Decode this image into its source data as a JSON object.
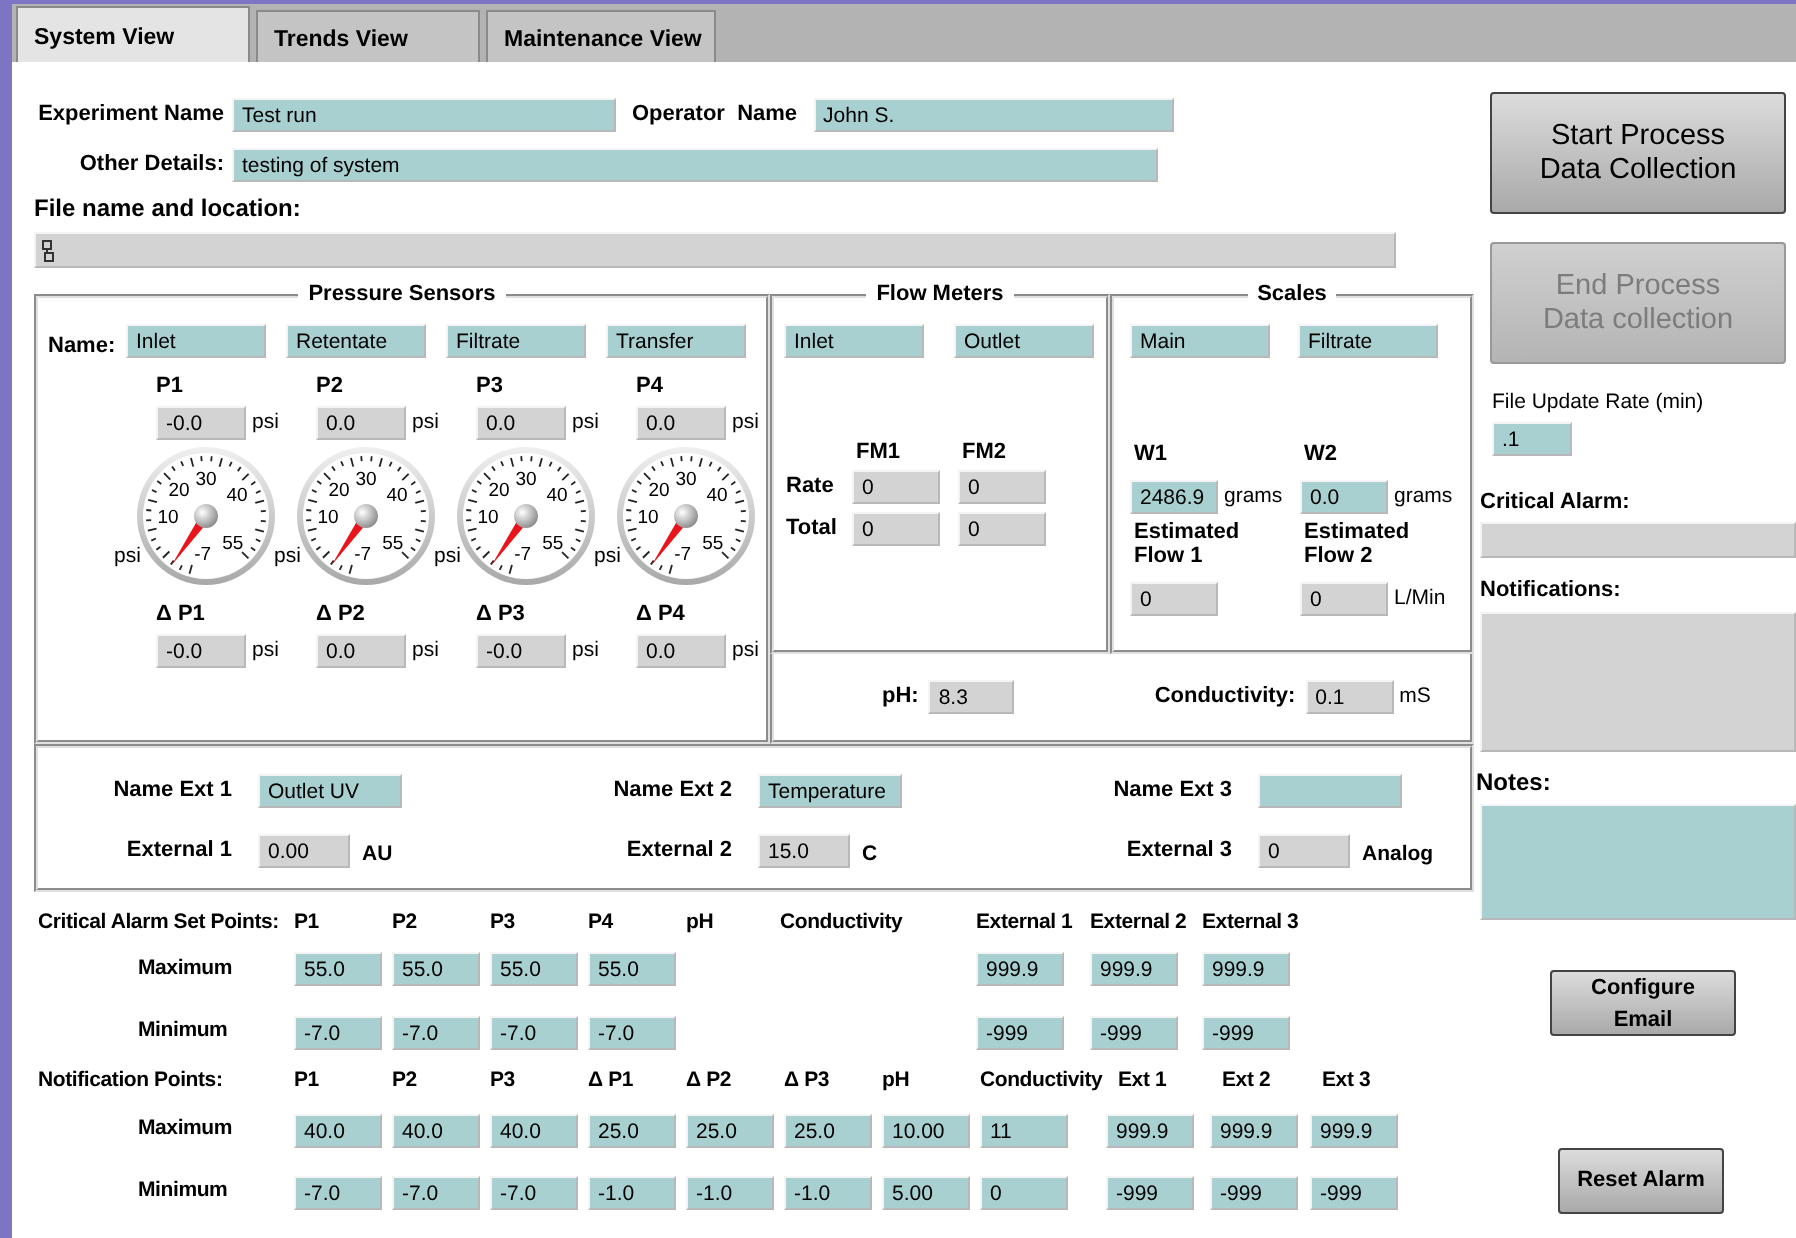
{
  "tabs": [
    {
      "label": "System View",
      "selected": true
    },
    {
      "label": "Trends View",
      "selected": false
    },
    {
      "label": "Maintenance View",
      "selected": false
    }
  ],
  "experiment": {
    "name_label": "Experiment Name",
    "name": "Test run",
    "operator_label": "Operator  Name",
    "operator": "John S.",
    "details_label": "Other Details:",
    "details": "testing of system",
    "file_label": "File name and location:"
  },
  "pressure": {
    "title": "Pressure Sensors",
    "name_label": "Name:",
    "sensors": [
      {
        "name": "Inlet",
        "label": "P1",
        "value": "-0.0",
        "unit": "psi",
        "gauge_unit": "psi",
        "scale": [
          "30",
          "20",
          "40",
          "10",
          "55",
          "-7"
        ],
        "delta_label": "Δ P1",
        "delta_value": "-0.0",
        "delta_unit": "psi"
      },
      {
        "name": "Retentate",
        "label": "P2",
        "value": "0.0",
        "unit": "psi",
        "gauge_unit": "psi",
        "scale": [
          "30",
          "20",
          "40",
          "10",
          "55",
          "-7"
        ],
        "delta_label": "Δ P2",
        "delta_value": "0.0",
        "delta_unit": "psi"
      },
      {
        "name": "Filtrate",
        "label": "P3",
        "value": "0.0",
        "unit": "psi",
        "gauge_unit": "psi",
        "scale": [
          "30",
          "20",
          "40",
          "10",
          "55",
          "-7"
        ],
        "delta_label": "Δ P3",
        "delta_value": "-0.0",
        "delta_unit": "psi"
      },
      {
        "name": "Transfer",
        "label": "P4",
        "value": "0.0",
        "unit": "psi",
        "gauge_unit": "psi",
        "scale": [
          "30",
          "20",
          "40",
          "10",
          "55",
          "-7"
        ],
        "delta_label": "Δ P4",
        "delta_value": "0.0",
        "delta_unit": "psi"
      }
    ]
  },
  "flow": {
    "title": "Flow Meters",
    "names": [
      "Inlet",
      "Outlet"
    ],
    "columns": [
      "FM1",
      "FM2"
    ],
    "rows": [
      {
        "label": "Rate",
        "values": [
          "0",
          "0"
        ]
      },
      {
        "label": "Total",
        "values": [
          "0",
          "0"
        ]
      }
    ]
  },
  "scales": {
    "title": "Scales",
    "names": [
      "Main",
      "Filtrate"
    ],
    "items": [
      {
        "label": "W1",
        "value": "2486.9",
        "unit": "grams",
        "flow_label": "Estimated Flow 1",
        "flow_value": "0"
      },
      {
        "label": "W2",
        "value": "0.0",
        "unit": "grams",
        "flow_label": "Estimated Flow 2",
        "flow_value": "0",
        "flow_unit": "L/Min"
      }
    ]
  },
  "water": {
    "ph_label": "pH:",
    "ph": "8.3",
    "cond_label": "Conductivity:",
    "cond": "0.1",
    "cond_unit": "mS"
  },
  "externals": [
    {
      "name_label": "Name Ext 1",
      "name": "Outlet UV",
      "label": "External 1",
      "value": "0.00",
      "unit": "AU"
    },
    {
      "name_label": "Name Ext 2",
      "name": "Temperature",
      "label": "External 2",
      "value": "15.0",
      "unit": "C"
    },
    {
      "name_label": "Name Ext 3",
      "label": "External 3",
      "value": "0",
      "unit": "Analog"
    }
  ],
  "critical": {
    "title": "Critical Alarm Set Points:",
    "columns": [
      "P1",
      "P2",
      "P3",
      "P4",
      "pH",
      "Conductivity",
      "External 1",
      "External 2",
      "External 3"
    ],
    "rows": [
      {
        "label": "Maximum",
        "values": [
          "55.0",
          "55.0",
          "55.0",
          "55.0"
        ],
        "external_values": [
          "999.9",
          "999.9",
          "999.9"
        ]
      },
      {
        "label": "Minimum",
        "values": [
          "-7.0",
          "-7.0",
          "-7.0",
          "-7.0"
        ],
        "external_values": [
          "-999",
          "-999",
          "-999"
        ]
      }
    ]
  },
  "notification": {
    "title": "Notification Points:",
    "columns": [
      "P1",
      "P2",
      "P3",
      "Δ P1",
      "Δ P2",
      "Δ P3",
      "pH",
      "Conductivity",
      "Ext 1",
      "Ext 2",
      "Ext 3"
    ],
    "rows": [
      {
        "label": "Maximum",
        "values": [
          "40.0",
          "40.0",
          "40.0",
          "25.0",
          "25.0",
          "25.0",
          "10.00",
          "11",
          "999.9",
          "999.9",
          "999.9"
        ]
      },
      {
        "label": "Minimum",
        "values": [
          "-7.0",
          "-7.0",
          "-7.0",
          "-1.0",
          "-1.0",
          "-1.0",
          "5.00",
          "0",
          "-999",
          "-999",
          "-999"
        ]
      }
    ]
  },
  "controls": {
    "start": {
      "label": "Start Process Data Collection",
      "disabled": false
    },
    "end": {
      "label": "End Process Data collection",
      "disabled": true
    },
    "update_rate_label": "File Update Rate (min)",
    "update_rate": ".1",
    "critical_alarm_label": "Critical Alarm:",
    "notifications_label": "Notifications:",
    "notes_label": "Notes:",
    "email": "Configure Email",
    "reset": "Reset Alarm"
  }
}
